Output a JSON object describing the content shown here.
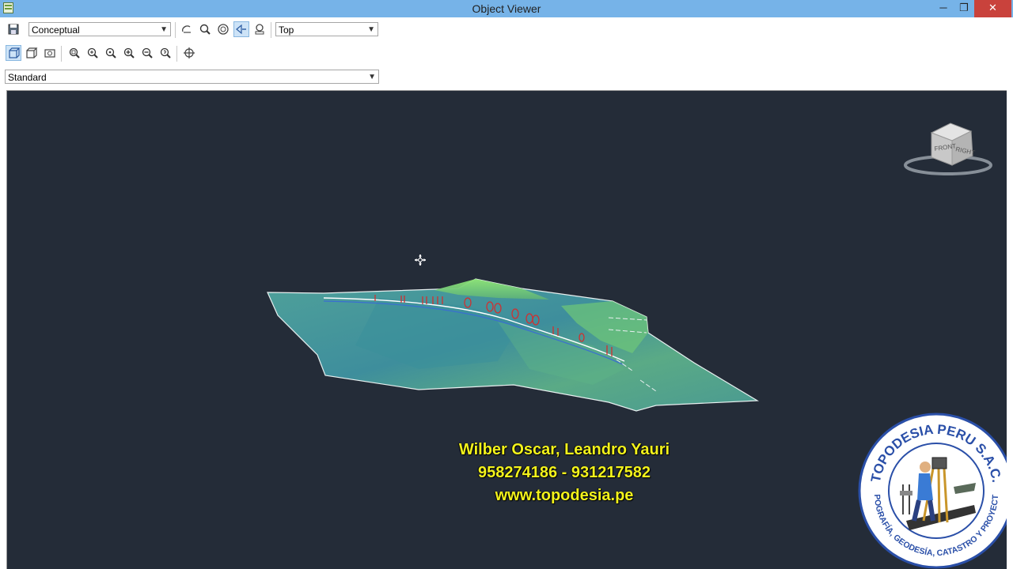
{
  "window": {
    "title": "Object Viewer",
    "controls": {
      "minimize": "─",
      "maximize": "❐",
      "close": "✕"
    }
  },
  "toolbar": {
    "visual_style": "Conceptual",
    "view_direction": "Top",
    "viewport_style": "Standard",
    "row1_icons": [
      "save-icon",
      "orbit-icon",
      "zoom-icon",
      "orbit-free-icon",
      "orbit-continuous-icon",
      "swivel-icon"
    ],
    "row2_icons": [
      "box-view-icon",
      "3d-box-icon",
      "camera-icon",
      "zoom-extents-icon",
      "zoom-window-icon",
      "zoom-realtime-icon",
      "zoom-in-icon",
      "zoom-out-icon",
      "zoom-previous-icon",
      "pan-icon"
    ]
  },
  "viewcube": {
    "face_front": "FRONT",
    "face_right": "RIGHT"
  },
  "overlay": {
    "author": "Wilber Oscar, Leandro Yauri",
    "phones": "958274186 - 931217582",
    "website": "www.topodesia.pe"
  },
  "logo": {
    "top_text": "TOPODESIA PERU S.A.C.",
    "bottom_text": "TOPOGRAFÍA, GEODESÍA, CATASTRO Y PROYECTOS"
  },
  "colors": {
    "title_bar": "#76b3e8",
    "viewport_bg": "#242c38",
    "terrain_base": "#4a9a9a",
    "terrain_highlight": "#8ee070",
    "alignment": "#d03030",
    "overlay_text": "#f2f21c",
    "logo_blue": "#2a4fa8"
  }
}
